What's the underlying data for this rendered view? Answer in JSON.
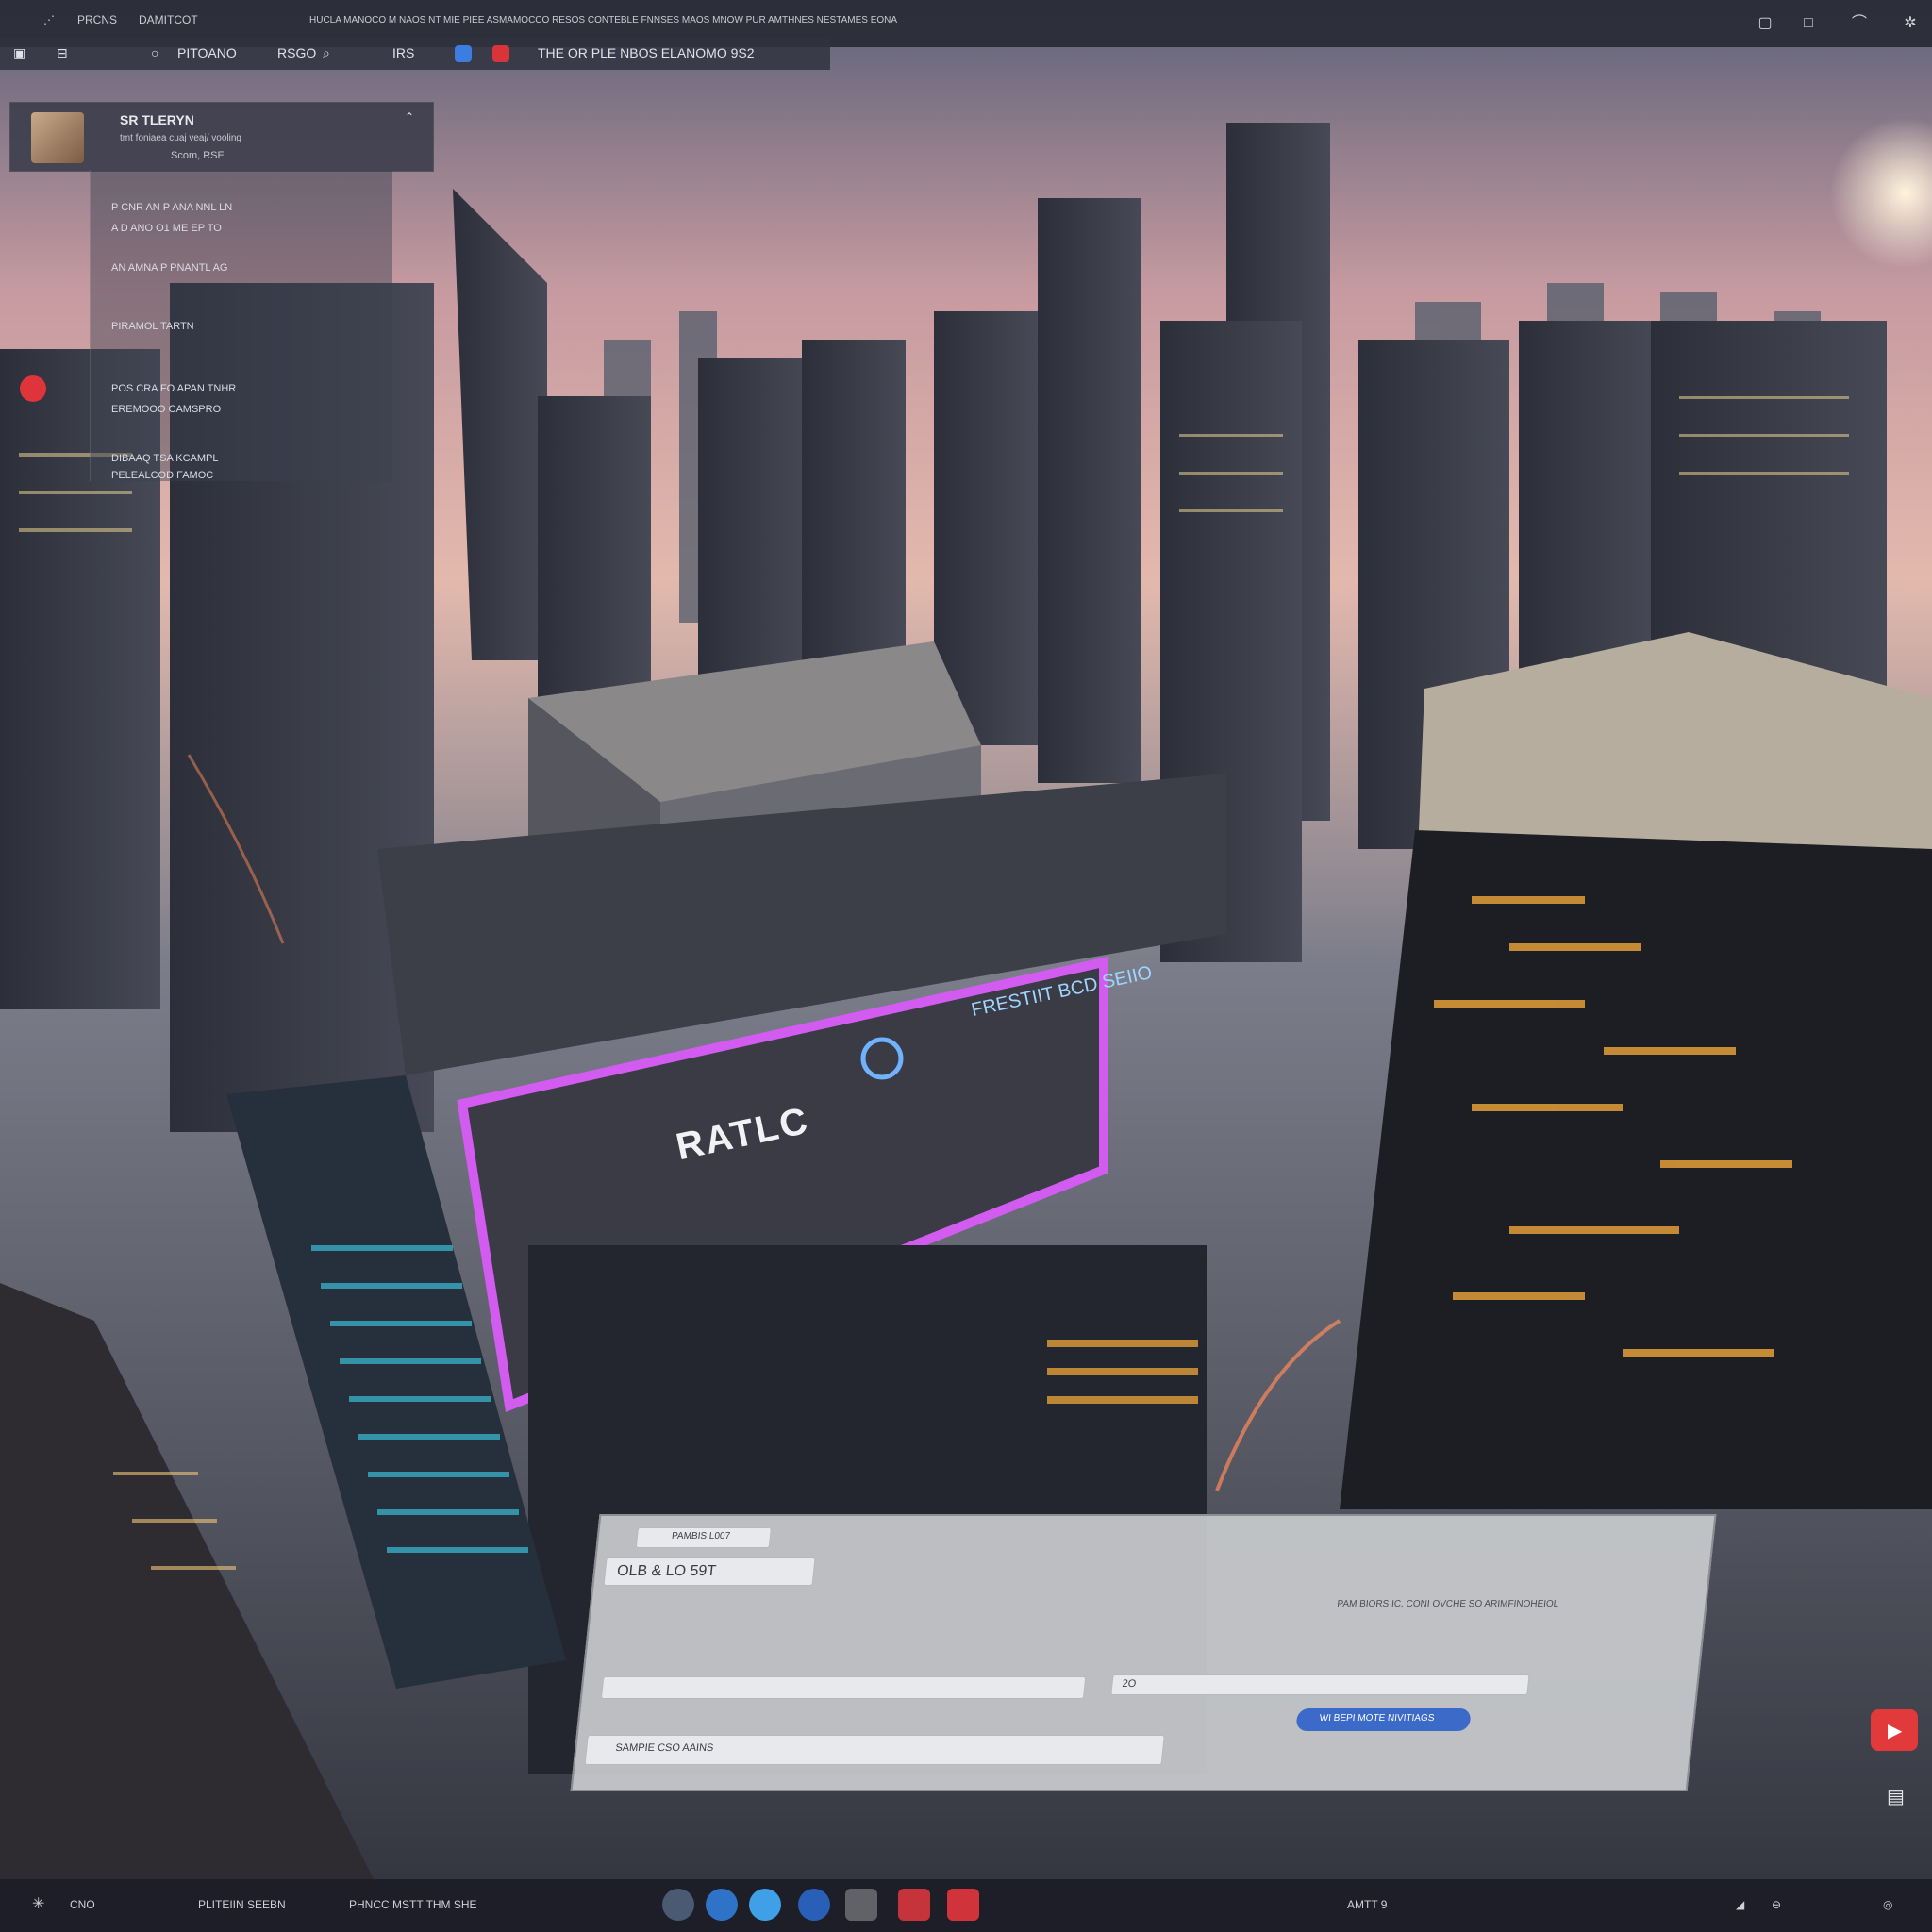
{
  "topbar": {
    "left_tab_1": "PRCNS",
    "left_tab_2": "DAMITCOT",
    "address": "HUCLA MANOCO M NAOS NT MIE PIEE ASMAMOCCO RESOS CONTEBLE FNNSES MAOS MNOW PUR AMTHNES NESTAMES EONA"
  },
  "toolbar": {
    "item_1": "PITOANO",
    "item_2": "RSGO",
    "item_3": "IRS",
    "title": "THE OR PLE NBOS ELANOMO 9S2"
  },
  "profile": {
    "name": "SR TLERYN",
    "sub": "tmt foniaea cuaj veaj/ vooling",
    "meta": "Scom, RSE"
  },
  "glass_lines": [
    "P CNR AN P ANA NNL LN",
    "A D ANO O1 ME EP TO",
    "AN AMNA P PNANTL AG",
    "PIRAMOL TARTN",
    "POS CRA FO APAN TNHR",
    "EREMOOO CAMSPRO",
    "DIBAAQ TSA KCAMPL",
    "PELEALCOD FAMOC"
  ],
  "signs": {
    "main": "RATLC",
    "secondary": "FRESTIIT BCD SEIIO"
  },
  "panel": {
    "tab_1": "PAMBIS L007",
    "heading": "OLB & LO 59T",
    "input": "SAMPIE CSO AAINS",
    "field_1": "2O",
    "button": "WI BEPI MOTE NIVITIAGS",
    "notes": "PAM BIORS IC, CONI OVCHE SO ARIMFINOHEIOL"
  },
  "taskbar": {
    "left_1": "CNO",
    "left_2": "PLITEIIN SEEBN",
    "search": "PHNCC MSTT THM SHE",
    "right": "AMTT 9"
  },
  "colors": {
    "accent_blue": "#3b7de0",
    "accent_red": "#d8343a",
    "neon_pink": "#d35cf0",
    "neon_cyan": "#3fd6f2",
    "window_amber": "#f0a63a"
  }
}
